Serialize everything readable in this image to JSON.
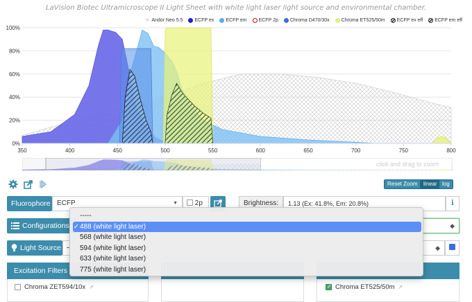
{
  "chart": {
    "title": "LaVision Biotec Ultramicroscope II Light Sheet with white light laser light source and environmental chamber.",
    "legend": [
      {
        "name": "Andor Neo 5.5",
        "marker": "cross",
        "color": "#bbbbbb"
      },
      {
        "name": "ECFP ex",
        "marker": "dot",
        "color": "#2222cc"
      },
      {
        "name": "ECFP em",
        "marker": "dot",
        "color": "#5aaaf0"
      },
      {
        "name": "ECFP 2p",
        "marker": "ring",
        "color": "#aa1111"
      },
      {
        "name": "Chroma D470/30x",
        "marker": "dot",
        "color": "#3a6fd8"
      },
      {
        "name": "Chroma ET525/50m",
        "marker": "dot",
        "color": "#dfee88"
      },
      {
        "name": "ECFP ex eff",
        "marker": "hatch",
        "color": "#222222"
      },
      {
        "name": "ECFP em eff",
        "marker": "hatch",
        "color": "#222222"
      }
    ],
    "zoom_hint": "click and drag to zoom",
    "buttons": {
      "reset_zoom": "Reset Zoom",
      "linear": "linear",
      "log": "log"
    }
  },
  "chart_data": {
    "type": "area",
    "x_range": [
      350,
      800
    ],
    "y_range": [
      0,
      100
    ],
    "x_ticks": [
      "350",
      "400",
      "450",
      "500",
      "550",
      "600",
      "650",
      "700",
      "750",
      "800"
    ],
    "y_ticks": [
      "0%",
      "20%",
      "40%",
      "60%",
      "80%",
      "100%"
    ],
    "grid": true,
    "series": [
      {
        "name": "Andor Neo 5.5",
        "color": "#cccccc",
        "points": [
          [
            350,
            7
          ],
          [
            380,
            14
          ],
          [
            420,
            22
          ],
          [
            460,
            30
          ],
          [
            500,
            40
          ],
          [
            540,
            52
          ],
          [
            580,
            60
          ],
          [
            620,
            60
          ],
          [
            660,
            57
          ],
          [
            700,
            52
          ],
          [
            740,
            44
          ],
          [
            780,
            35
          ],
          [
            800,
            31
          ]
        ]
      },
      {
        "name": "ECFP ex",
        "color": "#6a6ae8",
        "points": [
          [
            350,
            6
          ],
          [
            380,
            10
          ],
          [
            405,
            25
          ],
          [
            420,
            50
          ],
          [
            430,
            85
          ],
          [
            435,
            98
          ],
          [
            440,
            98
          ],
          [
            448,
            96
          ],
          [
            455,
            90
          ],
          [
            460,
            70
          ],
          [
            465,
            50
          ],
          [
            470,
            30
          ],
          [
            480,
            15
          ],
          [
            490,
            5
          ],
          [
            500,
            1
          ],
          [
            510,
            0
          ]
        ]
      },
      {
        "name": "ECFP em",
        "color": "#7ec1f5",
        "points": [
          [
            440,
            0
          ],
          [
            455,
            20
          ],
          [
            465,
            65
          ],
          [
            470,
            80
          ],
          [
            476,
            98
          ],
          [
            482,
            95
          ],
          [
            488,
            84
          ],
          [
            493,
            83
          ],
          [
            500,
            78
          ],
          [
            507,
            71
          ],
          [
            512,
            62
          ],
          [
            520,
            40
          ],
          [
            540,
            20
          ],
          [
            560,
            12
          ],
          [
            600,
            6
          ],
          [
            650,
            3
          ],
          [
            700,
            1
          ],
          [
            720,
            0
          ]
        ]
      },
      {
        "name": "Chroma D470/30x",
        "color": "#4f86e0",
        "points": [
          [
            452,
            0
          ],
          [
            454,
            80
          ],
          [
            456,
            82
          ],
          [
            485,
            82
          ],
          [
            487,
            0
          ]
        ]
      },
      {
        "name": "Chroma ET525/50m",
        "color": "#e4f27a",
        "points": [
          [
            498,
            0
          ],
          [
            500,
            98
          ],
          [
            502,
            100
          ],
          [
            548,
            100
          ],
          [
            550,
            0
          ]
        ]
      },
      {
        "name": "ECFP ex eff",
        "color": "#222222",
        "points": [
          [
            455,
            0
          ],
          [
            458,
            40
          ],
          [
            463,
            64
          ],
          [
            468,
            58
          ],
          [
            474,
            38
          ],
          [
            480,
            20
          ],
          [
            485,
            10
          ],
          [
            487,
            0
          ]
        ]
      },
      {
        "name": "ECFP em eff",
        "color": "#222222",
        "points": [
          [
            500,
            0
          ],
          [
            502,
            25
          ],
          [
            507,
            42
          ],
          [
            512,
            52
          ],
          [
            517,
            45
          ],
          [
            522,
            40
          ],
          [
            530,
            33
          ],
          [
            540,
            26
          ],
          [
            548,
            22
          ],
          [
            550,
            0
          ]
        ]
      },
      {
        "name": "minor peak",
        "color": "#dfee88",
        "points": [
          [
            780,
            0
          ],
          [
            786,
            5
          ],
          [
            790,
            6
          ],
          [
            794,
            5
          ],
          [
            800,
            0
          ]
        ]
      }
    ]
  },
  "controls": {
    "fluorophore": {
      "label": "Fluorophore",
      "value": "ECFP",
      "twop_label": "2p"
    },
    "brightness": {
      "label": "Brightness:",
      "value": "1.13 (Ex: 41.8%, Em: 20.8%)",
      "info": "i"
    },
    "configurations": {
      "label": "Configurations"
    },
    "light_source": {
      "label": "Light Source",
      "value": "–"
    }
  },
  "dropdown": {
    "items": [
      "-----",
      "488 (white light laser)",
      "568 (white light laser)",
      "594 (white light laser)",
      "633 (white light laser)",
      "775 (white light laser)"
    ],
    "selected": "488 (white light laser)"
  },
  "filters": {
    "excitation_header": "Excitation Filters",
    "excitation_item": "Chroma ZET594/10x",
    "emission_item": "Chroma ET525/50m"
  }
}
